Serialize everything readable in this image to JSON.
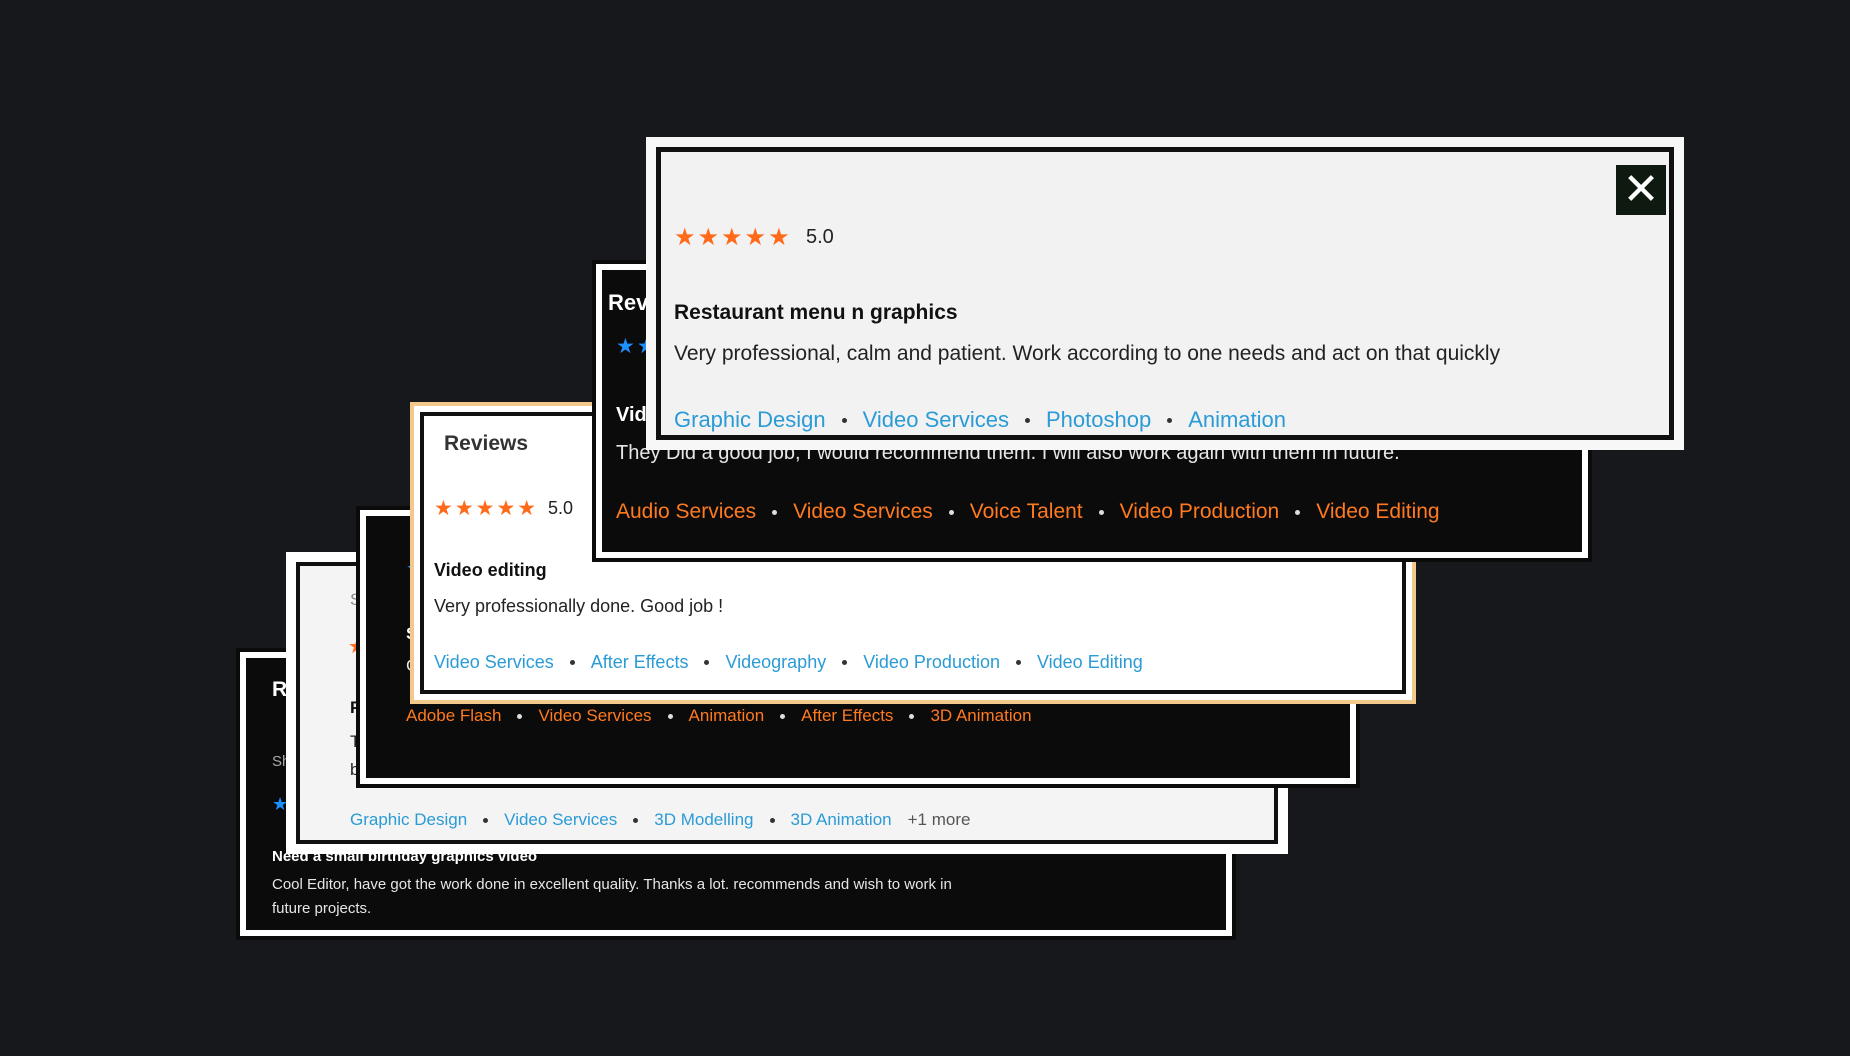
{
  "colors": {
    "background": "#17181b",
    "star_orange": "#ff6a1a",
    "star_blue": "#1e8fff",
    "tag_blue": "#2a9bd6",
    "tag_orange": "#ff7a1f"
  },
  "card1": {
    "heading": "Re",
    "sub": "Sh",
    "stars": "★",
    "title": "Need a small birthday graphics video",
    "body_line1": "Cool Editor, have got the work done in excellent quality. Thanks a lot. recommends and wish to work in",
    "body_line2": "future projects."
  },
  "card2": {
    "sub": "S",
    "stars": "★",
    "title": "P",
    "body_line1": "T",
    "body_line2": "b",
    "tags": [
      "Graphic Design",
      "Video Services",
      "3D Modelling",
      "3D Animation"
    ],
    "more": "+1 more"
  },
  "card3": {
    "stars": "★",
    "title": "S",
    "body": "C",
    "tags": [
      "Adobe Flash",
      "Video Services",
      "Animation",
      "After Effects",
      "3D Animation"
    ]
  },
  "card4": {
    "heading": "Reviews",
    "stars": "★★★★★",
    "rating": "5.0",
    "title": "Video editing",
    "body": "Very professionally done. Good job !",
    "tags": [
      "Video Services",
      "After Effects",
      "Videography",
      "Video Production",
      "Video Editing"
    ]
  },
  "card5": {
    "heading": "Revi",
    "stars": "★★",
    "title": "Vid",
    "body": "They Did a good job, I would recommend them. I will also work again with them in future.",
    "tags": [
      "Audio Services",
      "Video Services",
      "Voice Talent",
      "Video Production",
      "Video Editing"
    ]
  },
  "card6": {
    "stars": "★★★★★",
    "rating": "5.0",
    "title": "Restaurant menu n graphics",
    "body": "Very professional, calm and patient. Work according to one needs and act on that quickly",
    "tags": [
      "Graphic Design",
      "Video Services",
      "Photoshop",
      "Animation"
    ],
    "close_icon": "close-icon",
    "close_glyph": "✕"
  }
}
